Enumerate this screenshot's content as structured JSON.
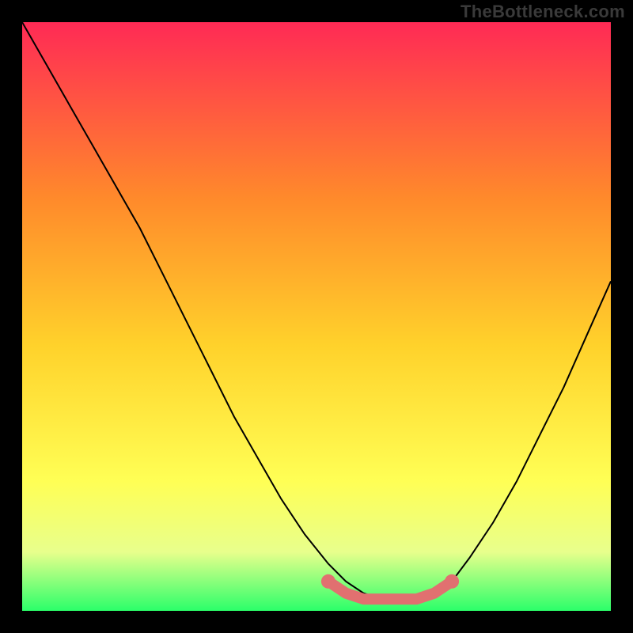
{
  "watermark": {
    "text": "TheBottleneck.com"
  },
  "colors": {
    "background": "#000000",
    "gradient_top": "#ff2a55",
    "gradient_mid_upper": "#ff8a2b",
    "gradient_mid": "#ffd22b",
    "gradient_mid_lower": "#ffff55",
    "gradient_lower": "#e8ff8c",
    "gradient_bottom": "#2bff6a",
    "curve": "#000000",
    "marker": "#e17070",
    "watermark": "#3a3a3a"
  },
  "chart_data": {
    "type": "line",
    "title": "",
    "xlabel": "",
    "ylabel": "",
    "xlim": [
      0,
      100
    ],
    "ylim": [
      0,
      100
    ],
    "grid": false,
    "series": [
      {
        "name": "bottleneck-curve",
        "x": [
          0,
          4,
          8,
          12,
          16,
          20,
          24,
          28,
          32,
          36,
          40,
          44,
          48,
          52,
          55,
          58,
          61,
          64,
          67,
          70,
          73,
          76,
          80,
          84,
          88,
          92,
          96,
          100
        ],
        "y": [
          100,
          93,
          86,
          79,
          72,
          65,
          57,
          49,
          41,
          33,
          26,
          19,
          13,
          8,
          5,
          3,
          2,
          2,
          2,
          3,
          5,
          9,
          15,
          22,
          30,
          38,
          47,
          56
        ]
      }
    ],
    "markers": {
      "name": "trough-markers",
      "x": [
        52,
        55,
        58,
        61,
        64,
        67,
        70,
        73
      ],
      "y": [
        5,
        3,
        2,
        2,
        2,
        2,
        3,
        5
      ]
    }
  }
}
